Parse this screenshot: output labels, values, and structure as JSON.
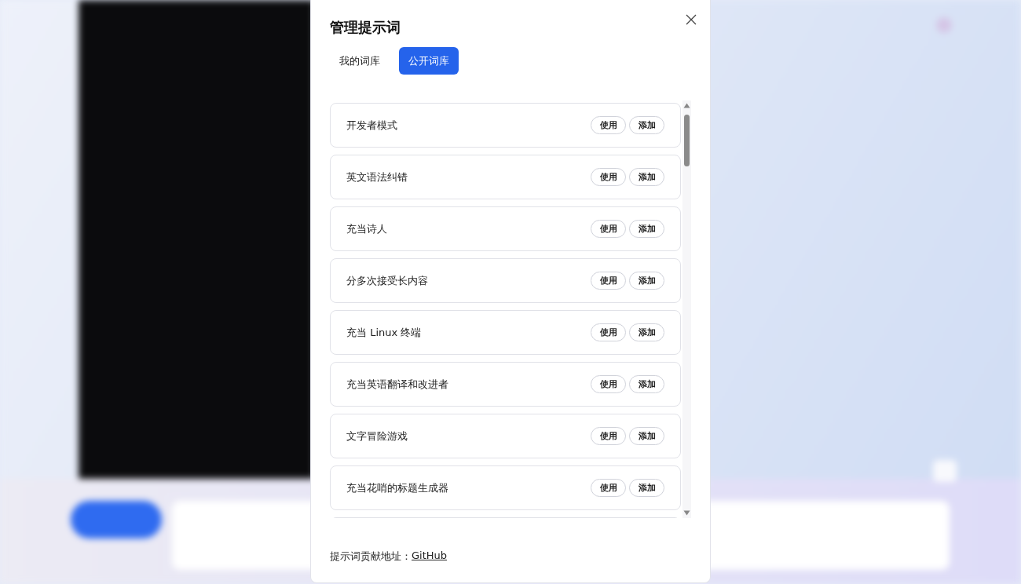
{
  "dialog": {
    "title": "管理提示词",
    "tabs": [
      {
        "label": "我的词库",
        "selected": false
      },
      {
        "label": "公开词库",
        "selected": true
      }
    ],
    "prompts": [
      {
        "name": "开发者模式",
        "actions": [
          "使用",
          "添加"
        ]
      },
      {
        "name": "英文语法纠错",
        "actions": [
          "使用",
          "添加"
        ]
      },
      {
        "name": "充当诗人",
        "actions": [
          "使用",
          "添加"
        ]
      },
      {
        "name": "分多次接受长内容",
        "actions": [
          "使用",
          "添加"
        ]
      },
      {
        "name": "充当 Linux 终端",
        "actions": [
          "使用",
          "添加"
        ]
      },
      {
        "name": "充当英语翻译和改进者",
        "actions": [
          "使用",
          "添加"
        ]
      },
      {
        "name": "文字冒险游戏",
        "actions": [
          "使用",
          "添加"
        ]
      },
      {
        "name": "充当花哨的标题生成器",
        "actions": [
          "使用",
          "添加"
        ]
      }
    ],
    "footer": {
      "label": "提示词贡献地址：",
      "link": "GitHub"
    }
  }
}
